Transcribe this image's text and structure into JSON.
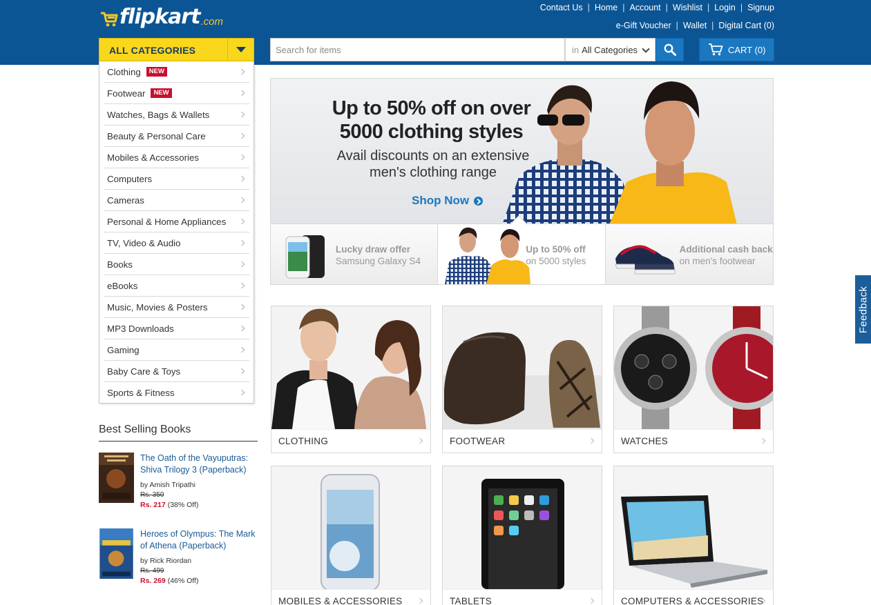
{
  "brand": {
    "name": "flipkart",
    "suffix": ".com",
    "yellow": "#f9d71c",
    "blue": "#0c5595",
    "accent": "#1b78c0"
  },
  "header": {
    "top_links": [
      "Contact Us",
      "Home",
      "Account",
      "Wishlist",
      "Login",
      "Signup"
    ],
    "sub_links": [
      "e-Gift Voucher",
      "Wallet",
      "Digital Cart (0)"
    ],
    "all_categories": "ALL CATEGORIES",
    "search_placeholder": "Search for items",
    "search_cat_prefix": "in",
    "search_cat_value": "All Categories",
    "cart_label": "CART (0)"
  },
  "categories": [
    {
      "label": "Clothing",
      "badge": "NEW"
    },
    {
      "label": "Footwear",
      "badge": "NEW"
    },
    {
      "label": "Watches, Bags & Wallets"
    },
    {
      "label": "Beauty & Personal Care"
    },
    {
      "label": "Mobiles & Accessories"
    },
    {
      "label": "Computers"
    },
    {
      "label": "Cameras"
    },
    {
      "label": "Personal & Home Appliances"
    },
    {
      "label": "TV, Video & Audio"
    },
    {
      "label": "Books"
    },
    {
      "label": "eBooks"
    },
    {
      "label": "Music, Movies & Posters"
    },
    {
      "label": "MP3 Downloads"
    },
    {
      "label": "Gaming"
    },
    {
      "label": "Baby Care & Toys"
    },
    {
      "label": "Sports & Fitness"
    }
  ],
  "best_selling": {
    "title": "Best Selling Books",
    "books": [
      {
        "title": "The Oath of the Vayuputras: Shiva Trilogy 3 (Paperback)",
        "author": "by Amish Tripathi",
        "mrp": "Rs. 350",
        "price": "Rs. 217",
        "discount": "(38% Off)"
      },
      {
        "title": "Heroes of Olympus: The Mark of Athena (Paperback)",
        "author": "by Rick Riordan",
        "mrp": "Rs. 499",
        "price": "Rs. 269",
        "discount": "(46% Off)"
      }
    ]
  },
  "hero": {
    "headline_1": "Up to 50% off on over",
    "headline_2": "5000 clothing styles",
    "sub_1": "Avail discounts on an extensive",
    "sub_2": "men's clothing range",
    "cta": "Shop Now"
  },
  "promos": [
    {
      "title": "Lucky draw offer",
      "subtitle": "Samsung Galaxy S4"
    },
    {
      "title": "Up to 50% off",
      "subtitle": "on 5000 styles"
    },
    {
      "title": "Additional cash back",
      "subtitle": "on men's footwear"
    }
  ],
  "tiles": [
    "CLOTHING",
    "FOOTWEAR",
    "WATCHES",
    "MOBILES & ACCESSORIES",
    "TABLETS",
    "COMPUTERS & ACCESSORIES"
  ],
  "feedback": "Feedback"
}
